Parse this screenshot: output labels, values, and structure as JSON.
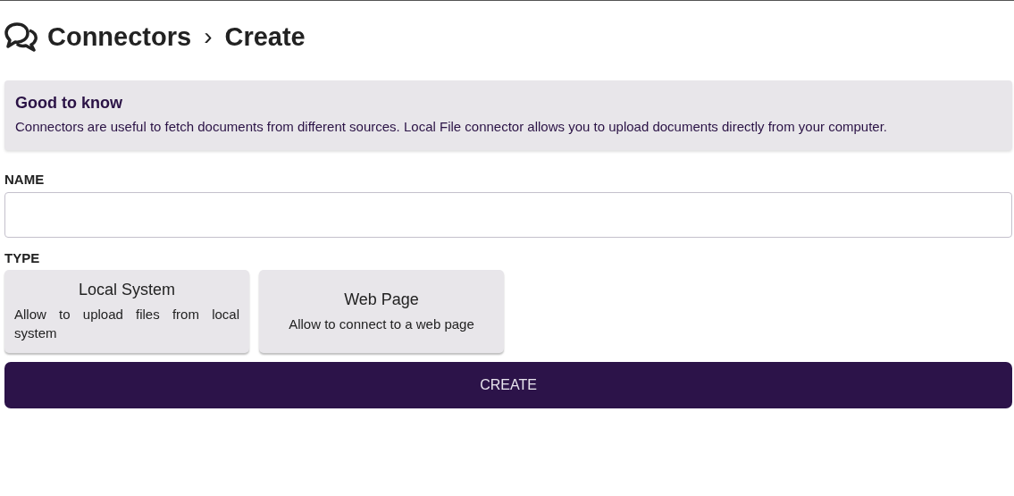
{
  "breadcrumb": {
    "section": "Connectors",
    "separator": "›",
    "page": "Create"
  },
  "info": {
    "title": "Good to know",
    "text": "Connectors are useful to fetch documents from different sources. Local File connector allows you to upload documents directly from your computer."
  },
  "name_field": {
    "label": "NAME"
  },
  "type_field": {
    "label": "TYPE",
    "options": [
      {
        "title": "Local System",
        "description": "Allow to upload files from local system"
      },
      {
        "title": "Web Page",
        "description": "Allow to connect to a web page"
      }
    ]
  },
  "submit": {
    "label": "CREATE"
  }
}
